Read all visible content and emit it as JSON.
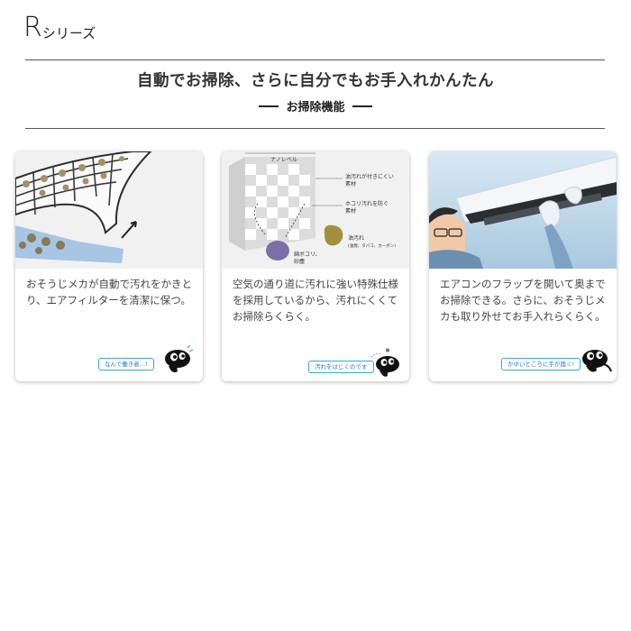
{
  "series": {
    "letter": "R",
    "suffix": "シリーズ"
  },
  "headline": "自動でお掃除、さらに自分でもお手入れかんたん",
  "subhead": "お掃除機能",
  "cards": [
    {
      "description": "おそうじメカが自動で汚れをかきとり、エアフィルターを清潔に保つ。",
      "badge": "なんで働き者…!",
      "mascot": "mascot-icon"
    },
    {
      "description": "空気の通り道に汚れに強い特殊仕様を採用しているから、汚れにくくてお掃除らくらく。",
      "badge": "汚れをはじくのです",
      "mascot": "mascot-icon",
      "labels": {
        "nano": "ナノレベル",
        "oil_resist_1": "油汚れが付きにくい",
        "oil_resist_2": "素材",
        "dust_resist_1": "ホコリ汚れを防ぐ",
        "dust_resist_2": "素材",
        "oil_1": "油汚れ",
        "oil_2": "(油煙、タバコ、カーボン)",
        "dust_1": "綿ボコリ、",
        "dust_2": "砂塵"
      }
    },
    {
      "description": "エアコンのフラップを開いて奥までお掃除できる。さらに、おそうじメカも取り外せてお手入れらくらく。",
      "badge": "かゆいところに手が届く!",
      "mascot": "mascot-icon"
    }
  ],
  "colors": {
    "badge": "#3aa6d9",
    "rule": "#555555",
    "text": "#333333"
  }
}
